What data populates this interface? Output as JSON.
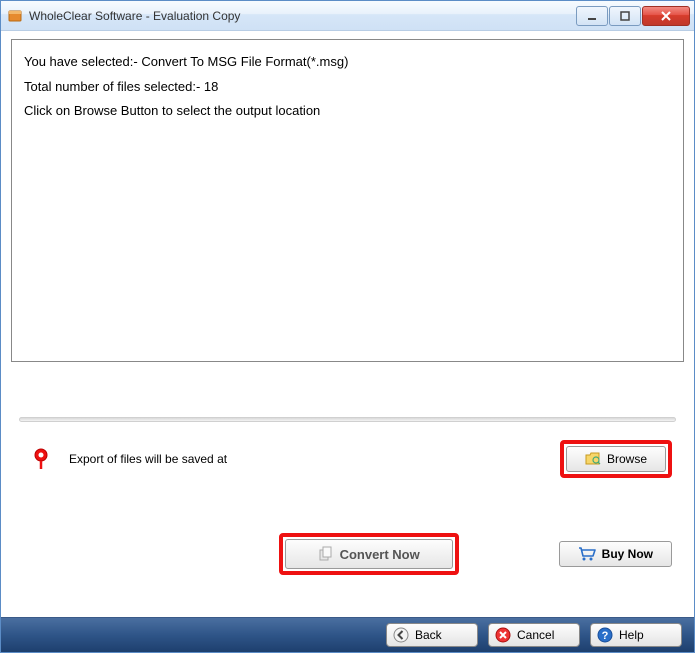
{
  "titlebar": {
    "title": "WholeClear Software - Evaluation Copy"
  },
  "info": {
    "line1": "You have selected:- Convert To MSG File Format(*.msg)",
    "line2": "Total number of files selected:- 18",
    "line3": "Click on Browse Button to select the output location"
  },
  "export": {
    "label": "Export of files will be saved at",
    "browse_label": "Browse"
  },
  "actions": {
    "convert_label": "Convert Now",
    "buynow_label": "Buy Now"
  },
  "bottom": {
    "back_label": "Back",
    "cancel_label": "Cancel",
    "help_label": "Help"
  }
}
